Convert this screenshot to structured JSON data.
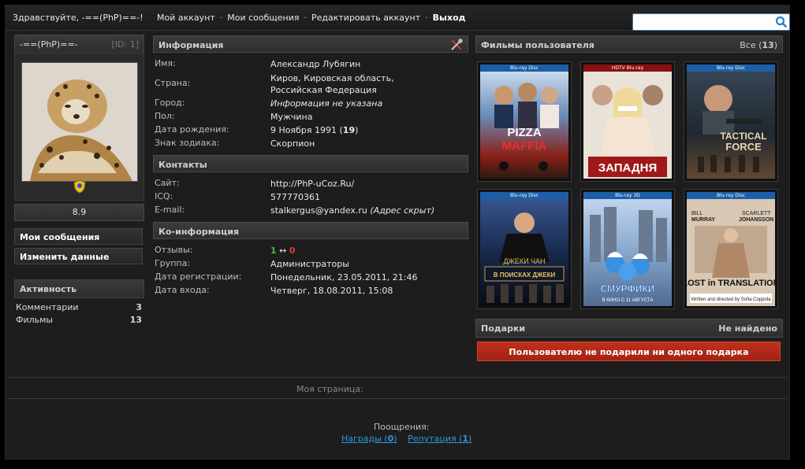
{
  "topbar": {
    "greeting": "Здравствуйте, -==(PhP)==-!",
    "nav": [
      "Мой аккаунт",
      "Мои сообщения",
      "Редактировать аккаунт",
      "Выход"
    ],
    "separator": "·",
    "search_placeholder": ""
  },
  "profile": {
    "nick": "-==(PhP)==-",
    "id_label": "[ID: 1]",
    "rating": "8.9",
    "buttons": [
      "Мои сообщения",
      "Изменить данные"
    ]
  },
  "activity": {
    "title": "Активность",
    "items": [
      {
        "label": "Комментарии",
        "value": "3"
      },
      {
        "label": "Фильмы",
        "value": "13"
      }
    ]
  },
  "info": {
    "title": "Информация",
    "rows": [
      {
        "k": "Имя:",
        "v": "Александр Лубягин"
      },
      {
        "k": "Страна:",
        "v": "Киров, Кировская область, Российская Федерация"
      },
      {
        "k": "Город:",
        "v": "Информация не указана"
      },
      {
        "k": "Пол:",
        "v": "Мужчина"
      },
      {
        "k": "Дата рождения:",
        "v": "9 Ноября 1991",
        "extra": "19"
      },
      {
        "k": "Знак зодиака:",
        "v": "Скорпион"
      }
    ]
  },
  "contacts": {
    "title": "Контакты",
    "rows": [
      {
        "k": "Сайт:",
        "v": "http://PhP-uCoz.Ru/"
      },
      {
        "k": "ICQ:",
        "v": "577770361"
      },
      {
        "k": "E-mail:",
        "v": "stalkergus@yandex.ru",
        "note": "(Адрес скрыт)"
      }
    ]
  },
  "coinfo": {
    "title": "Ко-информация",
    "reviews_label": "Отзывы:",
    "reviews_pos": "1",
    "reviews_arrow": "↔",
    "reviews_neg": "0",
    "rows": [
      {
        "k": "Группа:",
        "v": "Администраторы"
      },
      {
        "k": "Дата регистрации:",
        "v": "Понедельник, 23.05.2011, 21:46"
      },
      {
        "k": "Дата входа:",
        "v": "Четверг, 18.08.2011, 15:08"
      }
    ]
  },
  "films": {
    "title": "Фильмы пользователя",
    "all_label": "Все",
    "all_count": "13",
    "posters": [
      {
        "title": "PIZZA MAFFIA",
        "colors": [
          "#2a6ea8",
          "#b03020",
          "#e8c040"
        ]
      },
      {
        "title": "ЗАПАДНЯ",
        "colors": [
          "#e8e0d8",
          "#7a1010",
          "#ffffff"
        ]
      },
      {
        "title": "TACTICAL FORCE",
        "colors": [
          "#2a3440",
          "#c08040",
          "#e0d0b0"
        ]
      },
      {
        "title": "В ПОИСКАХ ДЖЕКИ",
        "colors": [
          "#1a3a70",
          "#0a0a0a",
          "#e8c060"
        ]
      },
      {
        "title": "СМУРФИКИ",
        "colors": [
          "#8ab0d8",
          "#3080d0",
          "#f0f0f0"
        ]
      },
      {
        "title": "LOST in TRANSLATION",
        "colors": [
          "#d8c8b8",
          "#a07050",
          "#202020"
        ]
      }
    ]
  },
  "gifts": {
    "title": "Подарки",
    "status": "Не найдено",
    "message": "Пользователю не подарили ни одного подарка"
  },
  "footer": {
    "mypage": "Моя страница:",
    "rewards": "Поощрения:",
    "awards_link": "Награды",
    "awards_count": "0",
    "rep_link": "Репутация",
    "rep_count": "1"
  }
}
